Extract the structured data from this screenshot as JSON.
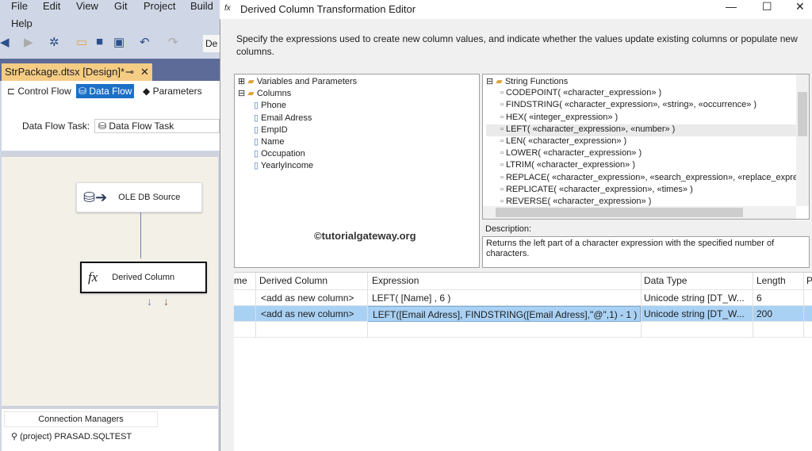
{
  "vs": {
    "menu": [
      "File",
      "Edit",
      "View",
      "Git",
      "Project",
      "Build",
      "Help"
    ],
    "toolbar_combo": "De",
    "doc_tab": "StrPackage.dtsx [Design]*",
    "pin": "⊸",
    "close": "✕",
    "designer_tabs": [
      "Control Flow",
      "Data Flow",
      "Parameters"
    ],
    "task_label": "Data Flow Task:",
    "task_value": "Data Flow Task",
    "components": {
      "source": "OLE DB Source",
      "derived": "Derived Column"
    },
    "conn_tab": "Connection Managers",
    "conn_item": "(project) PRASAD.SQLTEST"
  },
  "dialog": {
    "title": "Derived Column Transformation Editor",
    "instructions": "Specify the expressions used to create new column values, and indicate whether the values update existing columns or populate new columns.",
    "tree": {
      "vars": "Variables and Parameters",
      "columns": "Columns",
      "items": [
        "Phone",
        "Email Adress",
        "EmpID",
        "Name",
        "Occupation",
        "YearlyIncome"
      ]
    },
    "functions": {
      "group": "String Functions",
      "items": [
        "CODEPOINT( «character_expression» )",
        "FINDSTRING( «character_expression», «string», «occurrence» )",
        "HEX( «integer_expression» )",
        "LEFT( «character_expression», «number» )",
        "LEN( «character_expression» )",
        "LOWER( «character_expression» )",
        "LTRIM( «character_expression» )",
        "REPLACE( «character_expression», «search_expression», «replace_expression» )",
        "REPLICATE( «character_expression», «times» )",
        "REVERSE( «character_expression» )"
      ]
    },
    "watermark": "©tutorialgateway.org",
    "description_label": "Description:",
    "description": "Returns the left part of a character expression with the specified number of characters.",
    "grid": {
      "headers": [
        "me",
        "Derived Column",
        "Expression",
        "Data Type",
        "Length",
        "P"
      ],
      "rows": [
        [
          "",
          "<add as new column>",
          "LEFT( [Name] , 6 )",
          "Unicode string [DT_W...",
          "6"
        ],
        [
          "",
          "<add as new column>",
          "LEFT([Email Adress], FINDSTRING([Email Adress],\"@\",1) - 1 )",
          "Unicode string [DT_W...",
          "200"
        ]
      ]
    }
  }
}
